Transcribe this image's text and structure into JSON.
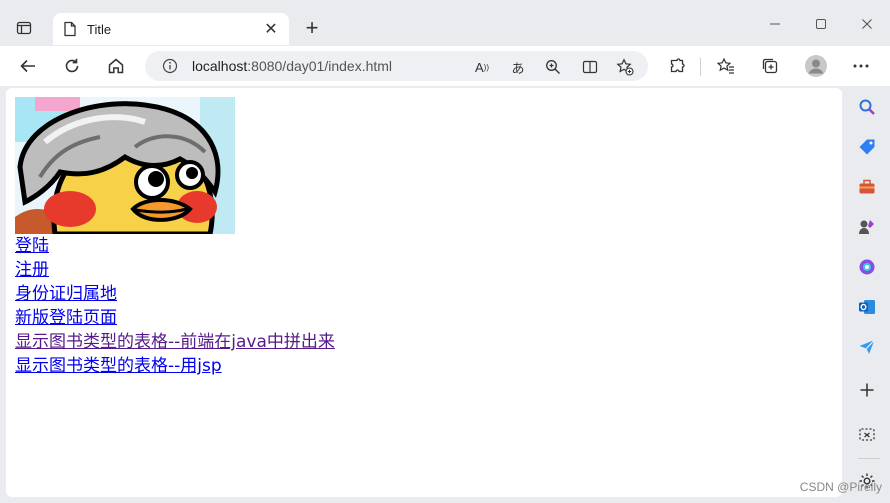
{
  "browser": {
    "tab_title": "Title",
    "address_host": "localhost",
    "address_rest": ":8080/day01/index.html"
  },
  "page": {
    "links": [
      {
        "label": "登陆",
        "visited": false
      },
      {
        "label": "注册",
        "visited": false
      },
      {
        "label": "身份证归属地",
        "visited": false
      },
      {
        "label": "新版登陆页面",
        "visited": false
      },
      {
        "label": "显示图书类型的表格--前端在java中拼出来",
        "visited": true
      },
      {
        "label": "显示图书类型的表格--用jsp",
        "visited": false
      }
    ]
  },
  "watermark": "CSDN @Pirelly"
}
